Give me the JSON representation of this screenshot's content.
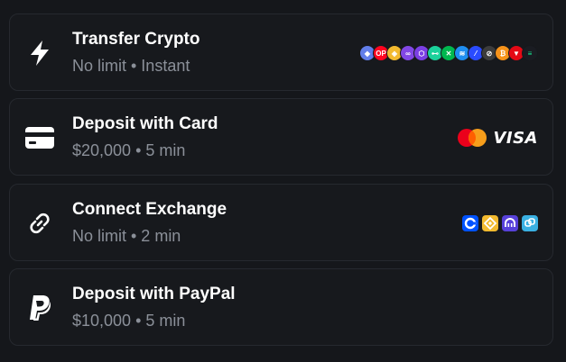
{
  "options": [
    {
      "title": "Transfer Crypto",
      "subtitle": "No limit • Instant",
      "icon": "lightning-bolt-icon",
      "logos": [
        {
          "name": "ethereum-icon",
          "color": "#627eea",
          "text": "◆"
        },
        {
          "name": "optimism-icon",
          "color": "#ff0420",
          "text": "OP"
        },
        {
          "name": "bnb-icon",
          "color": "#f3ba2f",
          "text": "◈"
        },
        {
          "name": "polygon-icon",
          "color": "#8247e5",
          "text": "∞"
        },
        {
          "name": "chainlink-icon",
          "color": "#7b3fe4",
          "text": "⬡"
        },
        {
          "name": "hyperliquid-icon",
          "color": "#1bd19b",
          "text": "⊷"
        },
        {
          "name": "flow-icon",
          "color": "#00b84f",
          "text": "✕"
        },
        {
          "name": "sui-icon",
          "color": "#1f8ef1",
          "text": "≋"
        },
        {
          "name": "zksync-icon",
          "color": "#2a4bff",
          "text": "⁄"
        },
        {
          "name": "worldcoin-icon",
          "color": "#3c3c3c",
          "text": "⊘"
        },
        {
          "name": "bitcoin-icon",
          "color": "#f7931a",
          "text": "₿"
        },
        {
          "name": "tron-icon",
          "color": "#e50915",
          "text": "▼"
        },
        {
          "name": "solana-icon",
          "color": "#1a1c22",
          "text": "≡"
        }
      ]
    },
    {
      "title": "Deposit with Card",
      "subtitle": "$20,000 • 5 min",
      "icon": "credit-card-icon",
      "brands": {
        "mastercard": "mastercard-icon",
        "visa": "VISA"
      }
    },
    {
      "title": "Connect Exchange",
      "subtitle": "No limit • 2 min",
      "icon": "link-icon",
      "exchanges": [
        {
          "name": "coinbase-icon",
          "color": "#0052ff"
        },
        {
          "name": "binance-icon",
          "color": "#f3ba2f"
        },
        {
          "name": "kraken-icon",
          "color": "#5741d9"
        },
        {
          "name": "okx-icon",
          "color": "#3ab0e2"
        }
      ]
    },
    {
      "title": "Deposit with PayPal",
      "subtitle": "$10,000 • 5 min",
      "icon": "paypal-icon"
    }
  ]
}
